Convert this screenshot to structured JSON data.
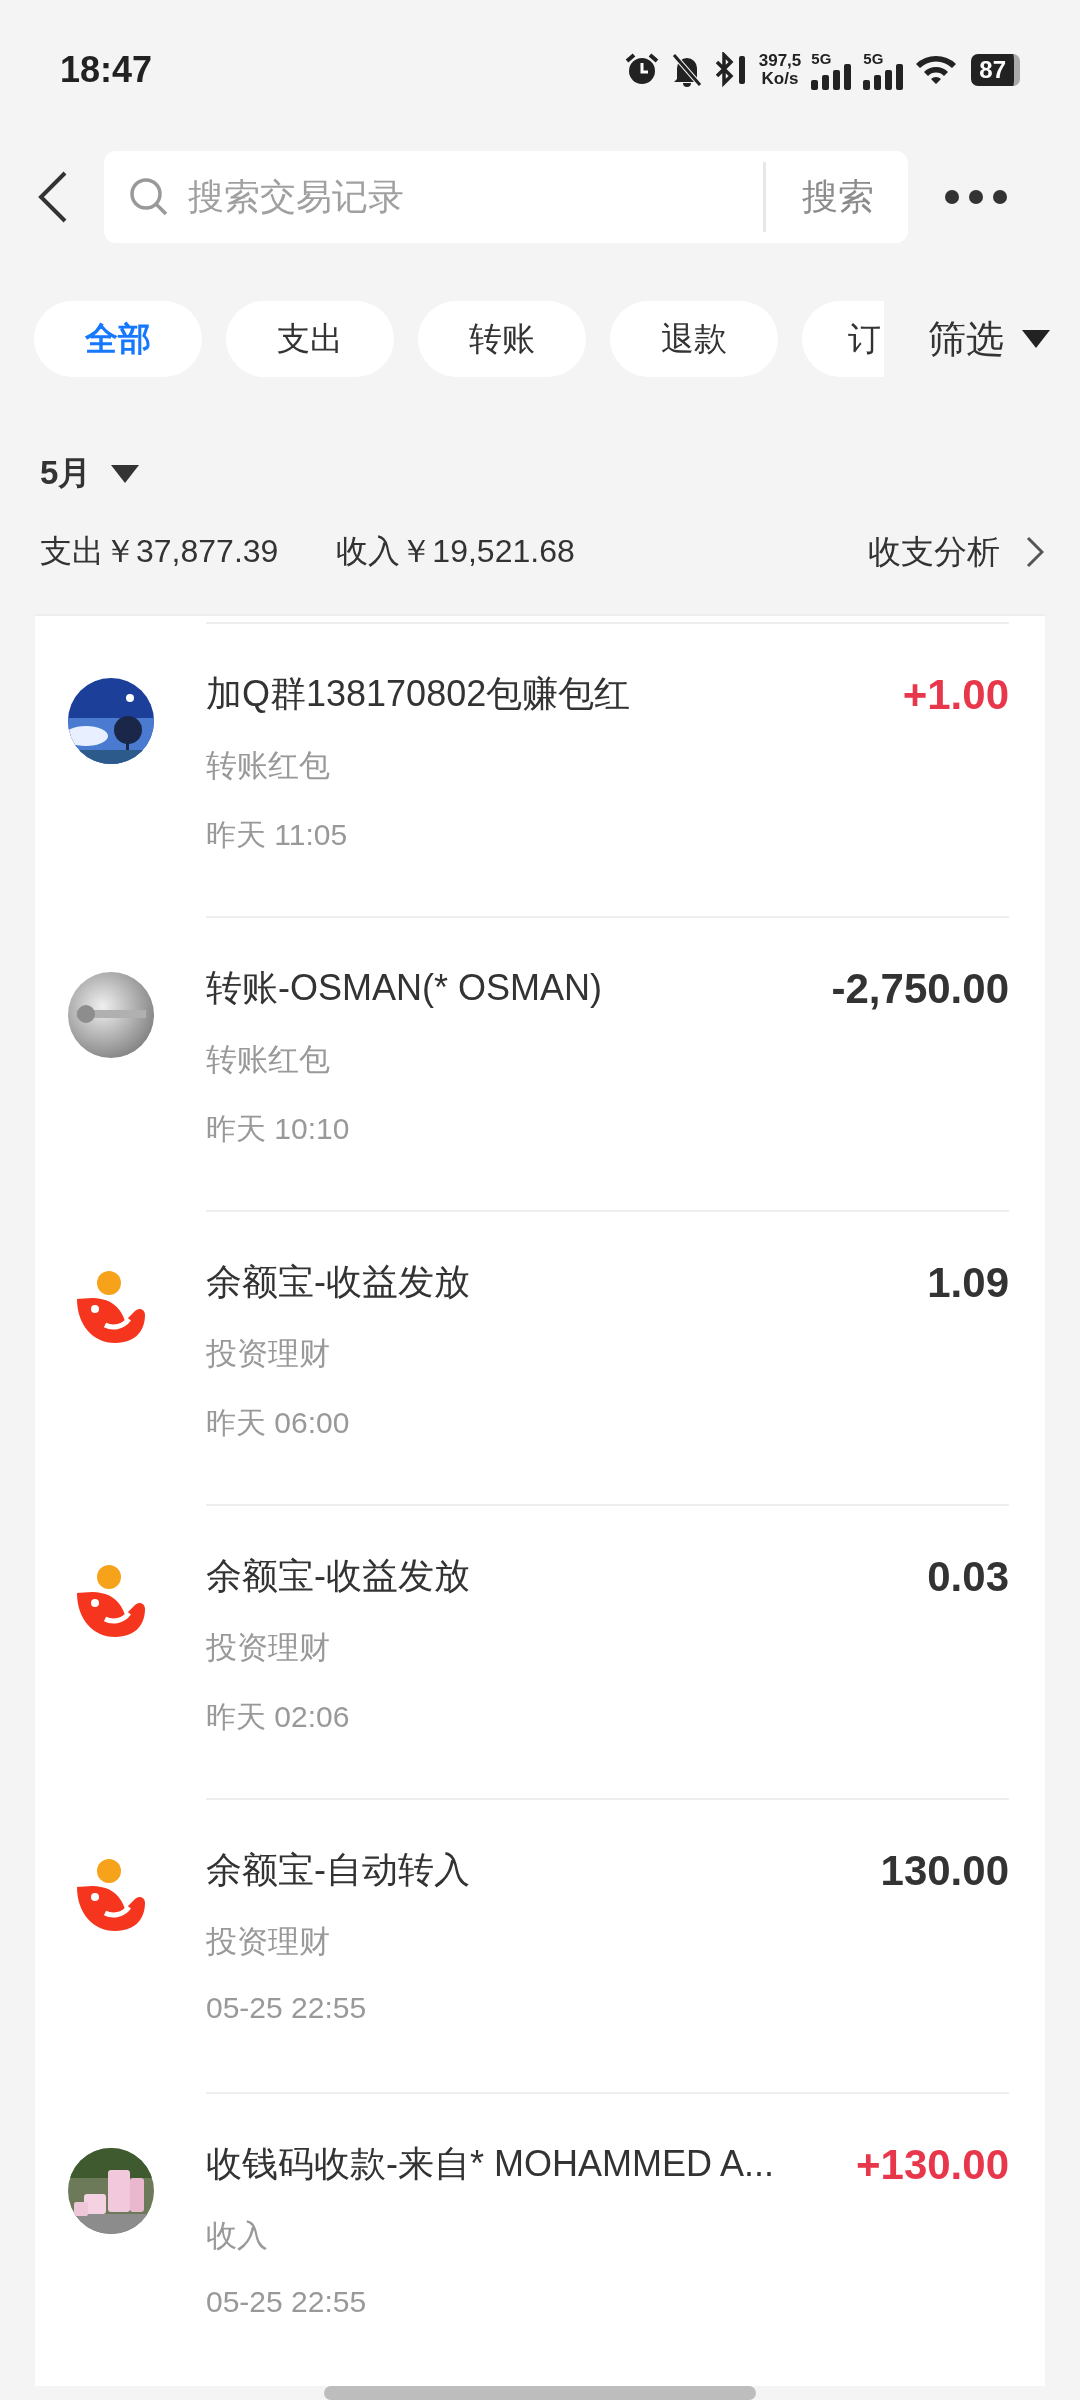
{
  "status_bar": {
    "time": "18:47",
    "net_speed": "397,5",
    "net_unit": "Ko/s",
    "sim_1": "5G",
    "sim_2": "5G",
    "battery": "87"
  },
  "search": {
    "placeholder": "搜索交易记录",
    "button": "搜索"
  },
  "tabs": [
    {
      "label": "全部",
      "selected": true
    },
    {
      "label": "支出",
      "selected": false
    },
    {
      "label": "转账",
      "selected": false
    },
    {
      "label": "退款",
      "selected": false
    },
    {
      "label": "订",
      "selected": false
    }
  ],
  "filter": "筛选",
  "summary": {
    "month": "5月",
    "expense": "支出￥37,877.39",
    "income": "收入￥19,521.68",
    "analysis": "收支分析"
  },
  "transactions": [
    {
      "kind": "picture",
      "title": "加Q群138170802包赚包红",
      "category": "转账红包",
      "time": "昨天 11:05",
      "amount": "+1.00",
      "color": "#e8374a"
    },
    {
      "kind": "picture",
      "title": "转账-OSMAN(* OSMAN)",
      "category": "转账红包",
      "time": "昨天 10:10",
      "amount": "-2,750.00",
      "color": "#333333"
    },
    {
      "kind": "logo",
      "title": "余额宝-收益发放",
      "category": "投资理财",
      "time": "昨天 06:00",
      "amount": "1.09",
      "color": "#333333"
    },
    {
      "kind": "logo",
      "title": "余额宝-收益发放",
      "category": "投资理财",
      "time": "昨天 02:06",
      "amount": "0.03",
      "color": "#333333"
    },
    {
      "kind": "logo",
      "title": "余额宝-自动转入",
      "category": "投资理财",
      "time": "05-25 22:55",
      "amount": "130.00",
      "color": "#333333"
    },
    {
      "kind": "picture",
      "title": "收钱码收款-来自* MOHAMMED A...",
      "category": "收入",
      "time": "05-25 22:55",
      "amount": "+130.00",
      "color": "#e8374a"
    }
  ]
}
